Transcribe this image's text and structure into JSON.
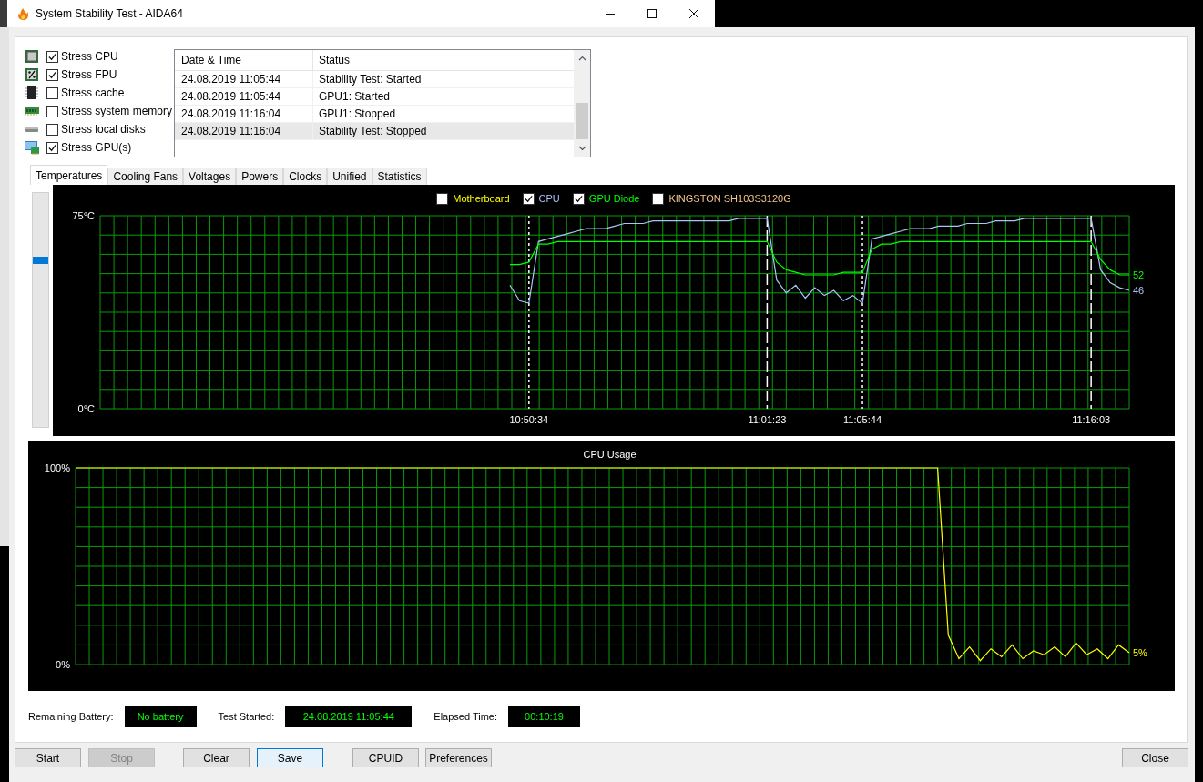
{
  "window": {
    "title": "System Stability Test - AIDA64"
  },
  "stress_options": [
    {
      "kind": "cpu",
      "label": "Stress CPU",
      "checked": true
    },
    {
      "kind": "fpu",
      "label": "Stress FPU",
      "checked": true
    },
    {
      "kind": "cache",
      "label": "Stress cache",
      "checked": false
    },
    {
      "kind": "memory",
      "label": "Stress system memory",
      "checked": false
    },
    {
      "kind": "disk",
      "label": "Stress local disks",
      "checked": false
    },
    {
      "kind": "gpu",
      "label": "Stress GPU(s)",
      "checked": true
    }
  ],
  "log": {
    "columns": [
      "Date & Time",
      "Status"
    ],
    "rows": [
      {
        "cells": [
          "24.08.2019 11:05:44",
          "Stability Test: Started"
        ],
        "selected": false
      },
      {
        "cells": [
          "24.08.2019 11:05:44",
          "GPU1: Started"
        ],
        "selected": false
      },
      {
        "cells": [
          "24.08.2019 11:16:04",
          "GPU1: Stopped"
        ],
        "selected": false
      },
      {
        "cells": [
          "24.08.2019 11:16:04",
          "Stability Test: Stopped"
        ],
        "selected": true
      }
    ]
  },
  "tabs": [
    {
      "label": "Temperatures",
      "selected": true
    },
    {
      "label": "Cooling Fans",
      "selected": false
    },
    {
      "label": "Voltages",
      "selected": false
    },
    {
      "label": "Powers",
      "selected": false
    },
    {
      "label": "Clocks",
      "selected": false
    },
    {
      "label": "Unified",
      "selected": false
    },
    {
      "label": "Statistics",
      "selected": false
    }
  ],
  "zoom_slider": {
    "level": 0.72
  },
  "temperature_chart": {
    "legend": [
      {
        "kind": "sensor",
        "label": "Motherboard",
        "checked": false,
        "color": "#ffff00"
      },
      {
        "kind": "series",
        "checked": true
      },
      {
        "kind": "series",
        "checked": true
      },
      {
        "kind": "sensor",
        "label": "KINGSTON SH103S3120G",
        "checked": false,
        "color": "#f5c68a"
      }
    ],
    "event_markers": [
      {
        "kind": "start"
      },
      {
        "kind": "stop"
      },
      {
        "kind": "start"
      },
      {
        "kind": "stop"
      }
    ],
    "chart_data": {
      "type": "line",
      "ylim": [
        0,
        75
      ],
      "yticks": [
        {
          "value": 0,
          "label": "0°C"
        },
        {
          "value": 75,
          "label": "75°C"
        }
      ],
      "categories": [
        null,
        null,
        null,
        null,
        null,
        null,
        null,
        null,
        null,
        null,
        null,
        null,
        null,
        null,
        null,
        null,
        null,
        null,
        null,
        null,
        null,
        null,
        null,
        null,
        null,
        null,
        null,
        null,
        null,
        null,
        null,
        null,
        null,
        null,
        null,
        null,
        null,
        null,
        null,
        null,
        null,
        null,
        null,
        null,
        null,
        "10:50:34",
        null,
        null,
        null,
        null,
        null,
        null,
        null,
        null,
        null,
        null,
        null,
        null,
        null,
        null,
        null,
        null,
        null,
        null,
        null,
        null,
        null,
        null,
        null,
        null,
        "11:01:23",
        null,
        null,
        null,
        null,
        null,
        null,
        null,
        null,
        null,
        "11:05:44",
        null,
        null,
        null,
        null,
        null,
        null,
        null,
        null,
        null,
        null,
        null,
        null,
        null,
        null,
        null,
        null,
        null,
        null,
        null,
        null,
        null,
        null,
        null,
        "11:16:03",
        null,
        null,
        null,
        null
      ],
      "series": [
        {
          "name": "CPU",
          "color": "#a9c4f5",
          "values": [
            null,
            null,
            null,
            null,
            null,
            null,
            null,
            null,
            null,
            null,
            null,
            null,
            null,
            null,
            null,
            null,
            null,
            null,
            null,
            null,
            null,
            null,
            null,
            null,
            null,
            null,
            null,
            null,
            null,
            null,
            null,
            null,
            null,
            null,
            null,
            null,
            null,
            null,
            null,
            null,
            null,
            null,
            null,
            48,
            42,
            41,
            65,
            66,
            67,
            68,
            69,
            70,
            70,
            70,
            71,
            72,
            72,
            72,
            73,
            73,
            73,
            73,
            73,
            73,
            73,
            73,
            73,
            74,
            74,
            74,
            74,
            50,
            45,
            48,
            43,
            47,
            44,
            46,
            42,
            44,
            41,
            66,
            67,
            68,
            69,
            70,
            70,
            70,
            71,
            71,
            71,
            72,
            72,
            72,
            73,
            73,
            73,
            74,
            74,
            74,
            74,
            74,
            74,
            74,
            74,
            54,
            49,
            47,
            46
          ]
        },
        {
          "name": "GPU Diode",
          "color": "#00ff00",
          "values": [
            null,
            null,
            null,
            null,
            null,
            null,
            null,
            null,
            null,
            null,
            null,
            null,
            null,
            null,
            null,
            null,
            null,
            null,
            null,
            null,
            null,
            null,
            null,
            null,
            null,
            null,
            null,
            null,
            null,
            null,
            null,
            null,
            null,
            null,
            null,
            null,
            null,
            null,
            null,
            null,
            null,
            null,
            null,
            56,
            56,
            57,
            64,
            64,
            65,
            65,
            65,
            65,
            65,
            65,
            65,
            65,
            65,
            65,
            65,
            65,
            65,
            65,
            65,
            65,
            65,
            65,
            65,
            65,
            65,
            65,
            65,
            57,
            54,
            53,
            52,
            52,
            52,
            52,
            53,
            53,
            53,
            62,
            64,
            64,
            65,
            65,
            65,
            65,
            65,
            65,
            65,
            65,
            65,
            65,
            65,
            65,
            65,
            65,
            65,
            65,
            65,
            65,
            65,
            65,
            65,
            58,
            54,
            52,
            52
          ]
        }
      ],
      "grid": true,
      "annotations": [
        "46",
        "52"
      ]
    }
  },
  "cpu_usage_chart": {
    "chart_data": {
      "type": "line",
      "title": "CPU Usage",
      "ylim": [
        0,
        100
      ],
      "yticks": [
        {
          "value": 0,
          "label": "0%"
        },
        {
          "value": 100,
          "label": "100%"
        }
      ],
      "categories": [
        null,
        null,
        null,
        null,
        null,
        null,
        null,
        null,
        null,
        null,
        null,
        null,
        null,
        null,
        null,
        null,
        null,
        null,
        null,
        null,
        null,
        null,
        null,
        null,
        null,
        null,
        null,
        null,
        null,
        null,
        null,
        null,
        null,
        null,
        null,
        null,
        null,
        null,
        null,
        null,
        null,
        null,
        null,
        null,
        null,
        null,
        null,
        null,
        null,
        null,
        null,
        null,
        null,
        null,
        null,
        null,
        null,
        null,
        null,
        null,
        null,
        null,
        null,
        null,
        null,
        null,
        null,
        null,
        null,
        null,
        null,
        null,
        null,
        null,
        null,
        null,
        null,
        null,
        null,
        null,
        null,
        null,
        null,
        null,
        null,
        null,
        null,
        null,
        null,
        null,
        null,
        null,
        null,
        null,
        null,
        null,
        null,
        null,
        null,
        null
      ],
      "series": [
        {
          "color": "#ffff00",
          "values": [
            100,
            100,
            100,
            100,
            100,
            100,
            100,
            100,
            100,
            100,
            100,
            100,
            100,
            100,
            100,
            100,
            100,
            100,
            100,
            100,
            100,
            100,
            100,
            100,
            100,
            100,
            100,
            100,
            100,
            100,
            100,
            100,
            100,
            100,
            100,
            100,
            100,
            100,
            100,
            100,
            100,
            100,
            100,
            100,
            100,
            100,
            100,
            100,
            100,
            100,
            100,
            100,
            100,
            100,
            100,
            100,
            100,
            100,
            100,
            100,
            100,
            100,
            100,
            100,
            100,
            100,
            100,
            100,
            100,
            100,
            100,
            100,
            100,
            100,
            100,
            100,
            100,
            100,
            100,
            100,
            100,
            100,
            15,
            3,
            9,
            2,
            8,
            4,
            10,
            3,
            7,
            5,
            9,
            4,
            11,
            5,
            8,
            3,
            10,
            6
          ]
        }
      ],
      "grid": true,
      "annotations": [
        "5%"
      ]
    }
  },
  "status": [
    {
      "label": "Remaining Battery:",
      "value": "No battery"
    },
    {
      "label": "Test Started:",
      "value": "24.08.2019 11:05:44"
    },
    {
      "label": "Elapsed Time:",
      "value": "00:10:19"
    }
  ],
  "buttons": [
    {
      "label": "Start",
      "disabled": false,
      "default": false
    },
    {
      "label": "Stop",
      "disabled": true,
      "default": false
    },
    {
      "label": "Clear",
      "disabled": false,
      "default": false
    },
    {
      "label": "Save",
      "disabled": false,
      "default": true
    },
    {
      "label": "CPUID",
      "disabled": false,
      "default": false
    },
    {
      "label": "Preferences",
      "disabled": false,
      "default": false
    },
    {
      "label": "Close",
      "disabled": false,
      "default": false
    }
  ]
}
